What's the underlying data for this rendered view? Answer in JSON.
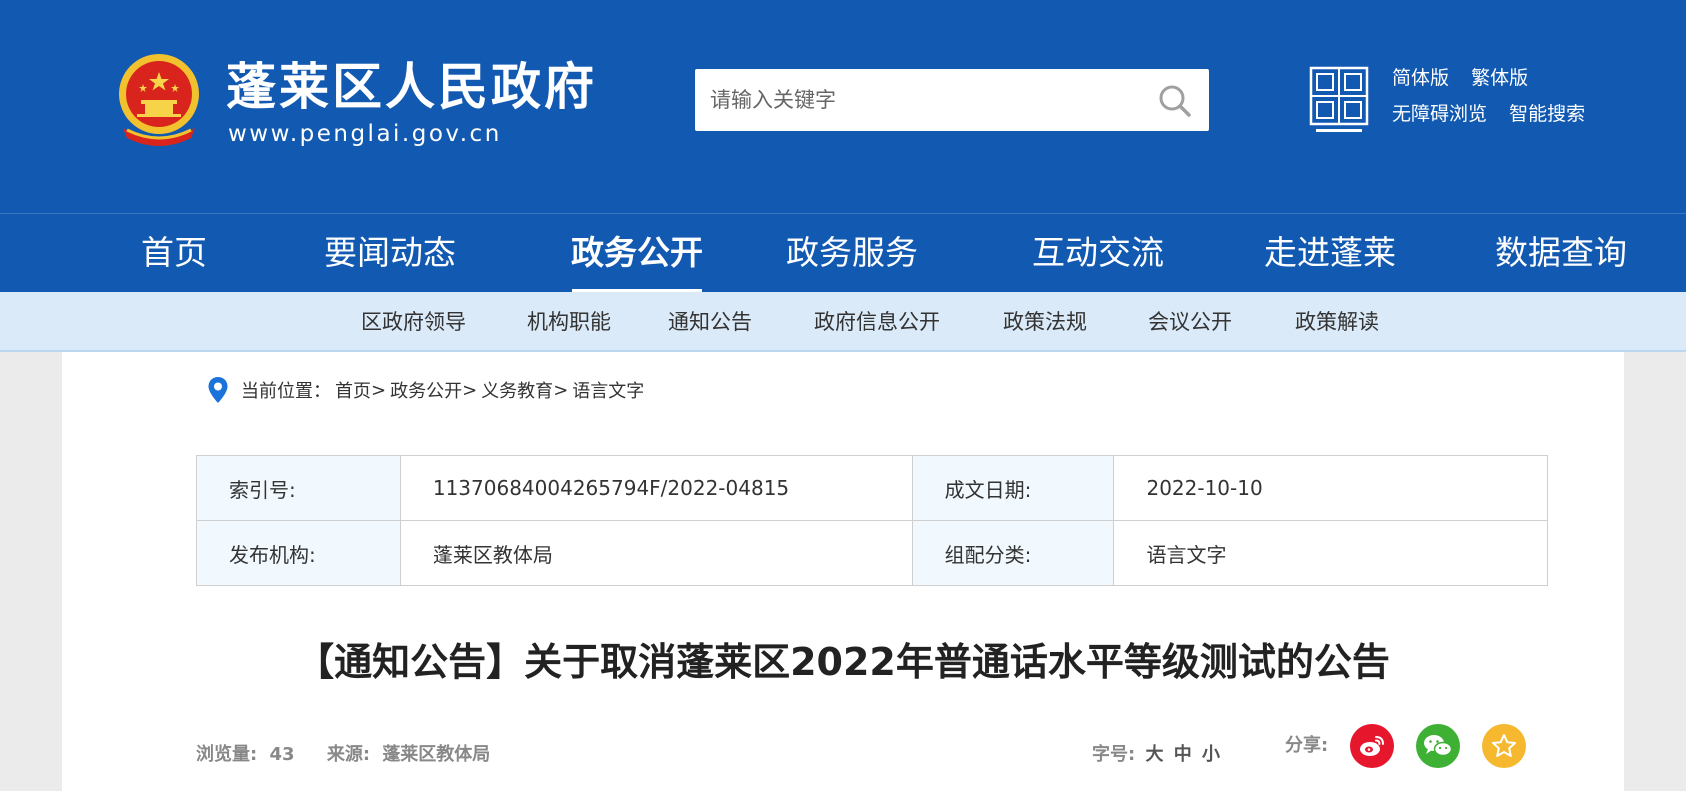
{
  "header": {
    "title": "蓬莱区人民政府",
    "url": "www.penglai.gov.cn",
    "search_placeholder": "请输入关键字",
    "links_row1": [
      "简体版",
      "繁体版"
    ],
    "links_row2": [
      "无障碍浏览",
      "智能搜索"
    ]
  },
  "nav": {
    "items": [
      "首页",
      "要闻动态",
      "政务公开",
      "政务服务",
      "互动交流",
      "走进蓬莱",
      "数据查询"
    ],
    "active": "政务公开"
  },
  "subnav": {
    "items": [
      "区政府领导",
      "机构职能",
      "通知公告",
      "政府信息公开",
      "政策法规",
      "会议公开",
      "政策解读"
    ]
  },
  "breadcrumb": {
    "label": "当前位置：",
    "items": [
      "首页",
      "政务公开",
      "义务教育",
      "语言文字"
    ],
    "separator": ">"
  },
  "meta": {
    "index_label": "索引号:",
    "index_value": "11370684004265794F/2022-04815",
    "date_label": "成文日期:",
    "date_value": "2022-10-10",
    "publisher_label": "发布机构:",
    "publisher_value": "蓬莱区教体局",
    "category_label": "组配分类:",
    "category_value": "语言文字"
  },
  "article": {
    "title": "【通知公告】关于取消蓬莱区2022年普通话水平等级测试的公告",
    "views_label": "浏览量:",
    "views_value": "43",
    "source_label": "来源:",
    "source_value": "蓬莱区教体局",
    "fontsize_label": "字号:",
    "fontsize_options": [
      "大",
      "中",
      "小"
    ],
    "share_label": "分享:"
  },
  "colors": {
    "primary_blue": "#1259b1",
    "subnav_bg": "#dbeaf8",
    "weibo": "#e6162d",
    "wechat": "#3eb135",
    "favorite": "#f5b82e"
  },
  "icons": [
    "national-emblem-icon",
    "search-icon",
    "yantai-china-seal-icon",
    "location-pin-icon",
    "weibo-icon",
    "wechat-icon",
    "favorite-star-icon"
  ]
}
